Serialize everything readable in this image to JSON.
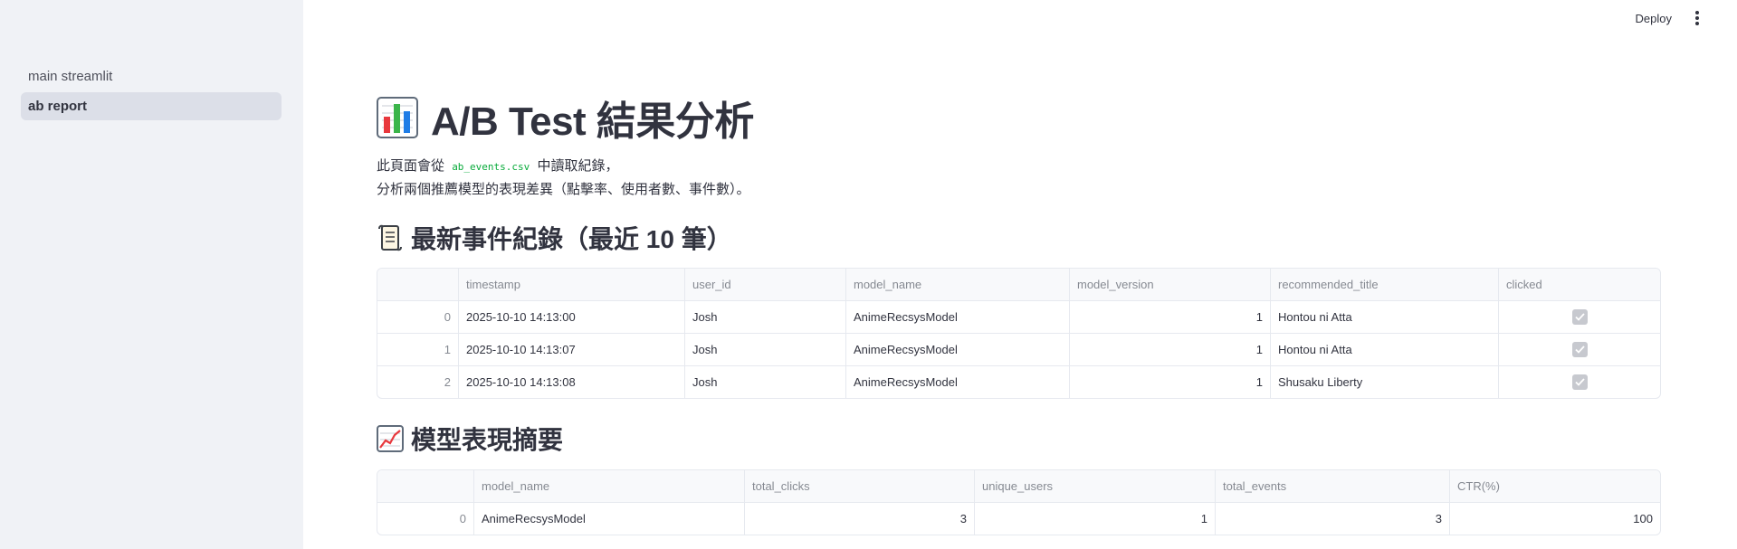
{
  "sidebar": {
    "items": [
      {
        "label": "main streamlit",
        "active": false
      },
      {
        "label": "ab report",
        "active": true
      }
    ]
  },
  "header": {
    "deploy_label": "Deploy"
  },
  "main": {
    "title_emoji": "bar-chart-icon",
    "title": "A/B Test 結果分析",
    "desc_line1_prefix": "此頁面會從",
    "desc_line1_code": "ab_events.csv",
    "desc_line1_suffix": "中讀取紀錄，",
    "desc_line2": "分析兩個推薦模型的表現差異（點擊率、使用者數、事件數）。",
    "events_section": {
      "icon": "scroll-icon",
      "title": "最新事件紀錄（最近 10 筆）",
      "columns": [
        "",
        "timestamp",
        "user_id",
        "model_name",
        "model_version",
        "recommended_title",
        "clicked"
      ],
      "rows": [
        {
          "index": "0",
          "timestamp": "2025-10-10 14:13:00",
          "user_id": "Josh",
          "model_name": "AnimeRecsysModel",
          "model_version": "1",
          "recommended_title": "Hontou ni Atta",
          "clicked": true
        },
        {
          "index": "1",
          "timestamp": "2025-10-10 14:13:07",
          "user_id": "Josh",
          "model_name": "AnimeRecsysModel",
          "model_version": "1",
          "recommended_title": "Hontou ni Atta",
          "clicked": true
        },
        {
          "index": "2",
          "timestamp": "2025-10-10 14:13:08",
          "user_id": "Josh",
          "model_name": "AnimeRecsysModel",
          "model_version": "1",
          "recommended_title": "Shusaku Liberty",
          "clicked": true
        }
      ]
    },
    "summary_section": {
      "icon": "chart-increasing-icon",
      "title": "模型表現摘要",
      "columns": [
        "",
        "model_name",
        "total_clicks",
        "unique_users",
        "total_events",
        "CTR(%)"
      ],
      "rows": [
        {
          "index": "0",
          "model_name": "AnimeRecsysModel",
          "total_clicks": "3",
          "unique_users": "1",
          "total_events": "3",
          "ctr": "100"
        }
      ]
    }
  },
  "colors": {
    "sidebar_bg": "#f0f2f6",
    "active_item_bg": "#dcdfe8",
    "text": "#31333f",
    "code_green": "#09ab3b",
    "table_border": "#e6e9ef",
    "header_text": "#868a92"
  }
}
